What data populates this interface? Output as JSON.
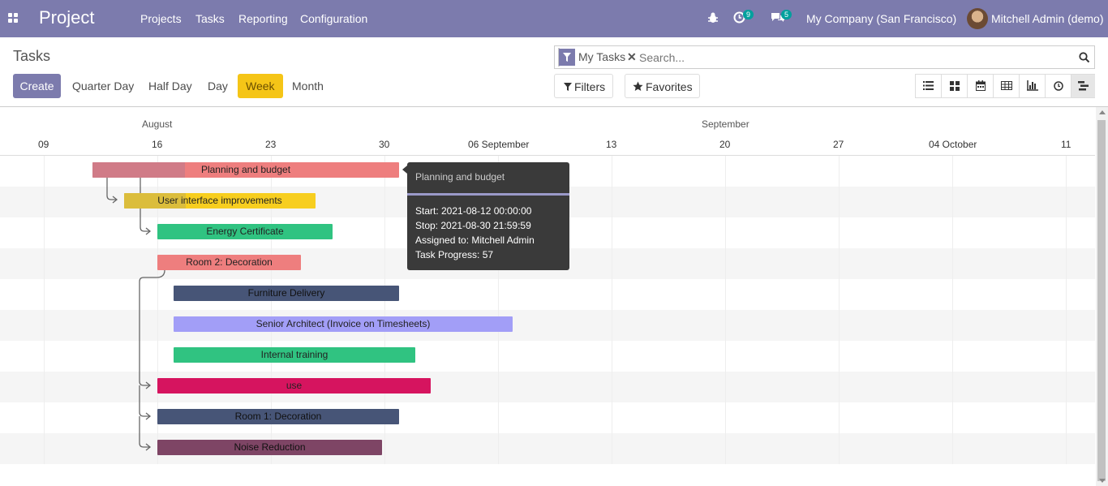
{
  "topbar": {
    "brand": "Project",
    "menu": [
      "Projects",
      "Tasks",
      "Reporting",
      "Configuration"
    ],
    "activity_count": "9",
    "messages_count": "5",
    "company": "My Company (San Francisco)",
    "user": "Mitchell Admin (demo)"
  },
  "control": {
    "title": "Tasks",
    "create": "Create",
    "scales": [
      "Quarter Day",
      "Half Day",
      "Day",
      "Week",
      "Month"
    ],
    "active_scale": "Week",
    "search_facet": "My Tasks",
    "search_placeholder": "Search...",
    "filters": "Filters",
    "favorites": "Favorites",
    "views": [
      "list-view",
      "kanban-view",
      "calendar-view",
      "pivot-view",
      "graph-view",
      "activity-view",
      "gantt-view"
    ],
    "active_view": "gantt-view"
  },
  "gantt": {
    "months": [
      "August",
      "September"
    ],
    "days": [
      "09",
      "16",
      "23",
      "30",
      "06 September",
      "13",
      "20",
      "27",
      "04 October",
      "11"
    ],
    "tasks": [
      {
        "name": "Planning and budget",
        "color": "#ee7e7e",
        "progress_color": "#d07b87"
      },
      {
        "name": "User interface improvements",
        "color": "#f7ce1f",
        "progress_color": "#dbbd3c"
      },
      {
        "name": "Energy Certificate",
        "color": "#30c381"
      },
      {
        "name": "Room 2: Decoration",
        "color": "#ee7e7e"
      },
      {
        "name": "Furniture Delivery",
        "color": "#475577"
      },
      {
        "name": "Senior Architect (Invoice on Timesheets)",
        "color": "#a29ef7"
      },
      {
        "name": "Internal training",
        "color": "#30c381"
      },
      {
        "name": "use",
        "color": "#d6145f"
      },
      {
        "name": "Room 1: Decoration",
        "color": "#475577"
      },
      {
        "name": "Noise Reduction",
        "color": "#7e4565"
      }
    ]
  },
  "tooltip": {
    "title": "Planning and budget",
    "start": "Start: 2021-08-12 00:00:00",
    "stop": "Stop: 2021-08-30 21:59:59",
    "assigned": "Assigned to: Mitchell Admin",
    "progress": "Task Progress: 57"
  }
}
